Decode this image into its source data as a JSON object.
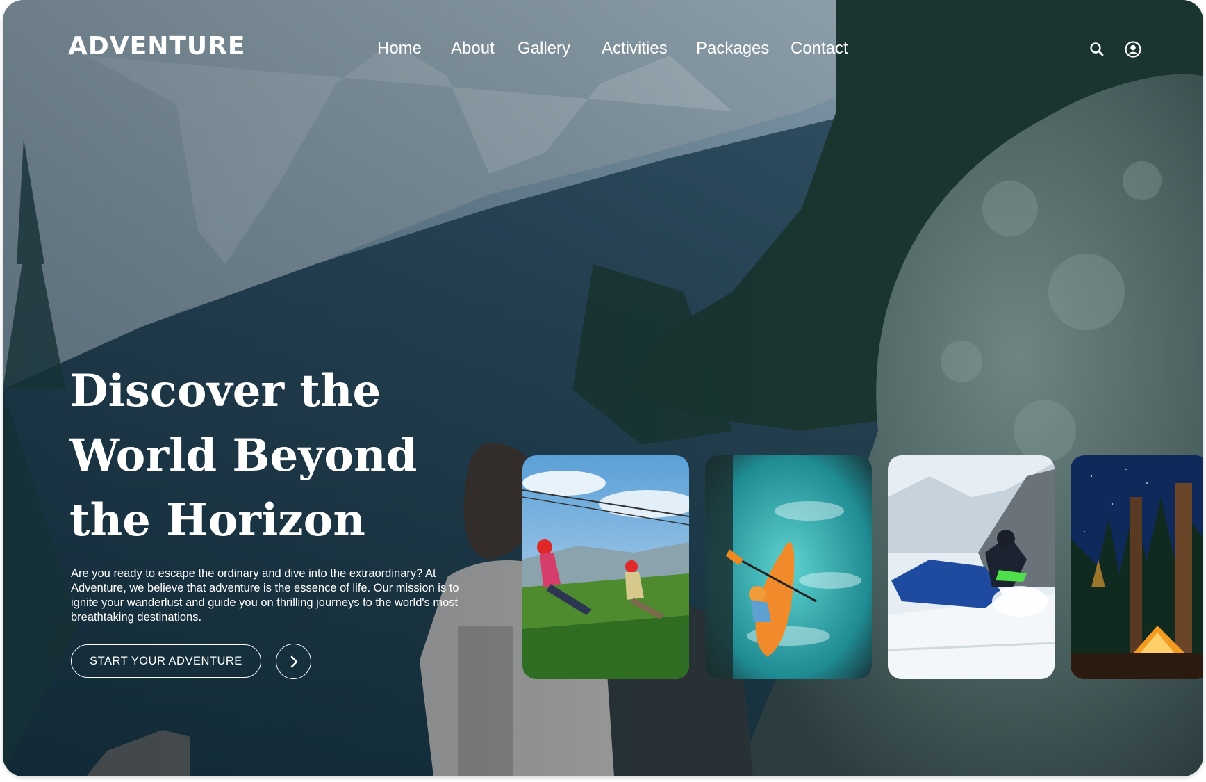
{
  "brand": {
    "logo": "ADVENTURE"
  },
  "nav": {
    "items": [
      "Home",
      "About",
      "Gallery",
      "Activities",
      "Packages",
      "Contact"
    ]
  },
  "icons": {
    "search": "search-icon",
    "account": "user-circle-icon",
    "arrow": "chevron-right-icon"
  },
  "hero": {
    "title_lines": [
      "Discover the",
      "World Beyond",
      "the Horizon"
    ],
    "description": "Are you ready to escape the ordinary and dive into the extraordinary? At Adventure, we believe that adventure is the essence of life. Our mission is to ignite your wanderlust and guide you on thrilling journeys to the world's most breathtaking destinations.",
    "cta_label": "START YOUR ADVENTURE"
  },
  "cards": [
    {
      "name": "zipline"
    },
    {
      "name": "kayaking"
    },
    {
      "name": "snowmobile"
    },
    {
      "name": "camping"
    }
  ],
  "colors": {
    "text": "#ffffff",
    "overlay": "#1d3340"
  }
}
